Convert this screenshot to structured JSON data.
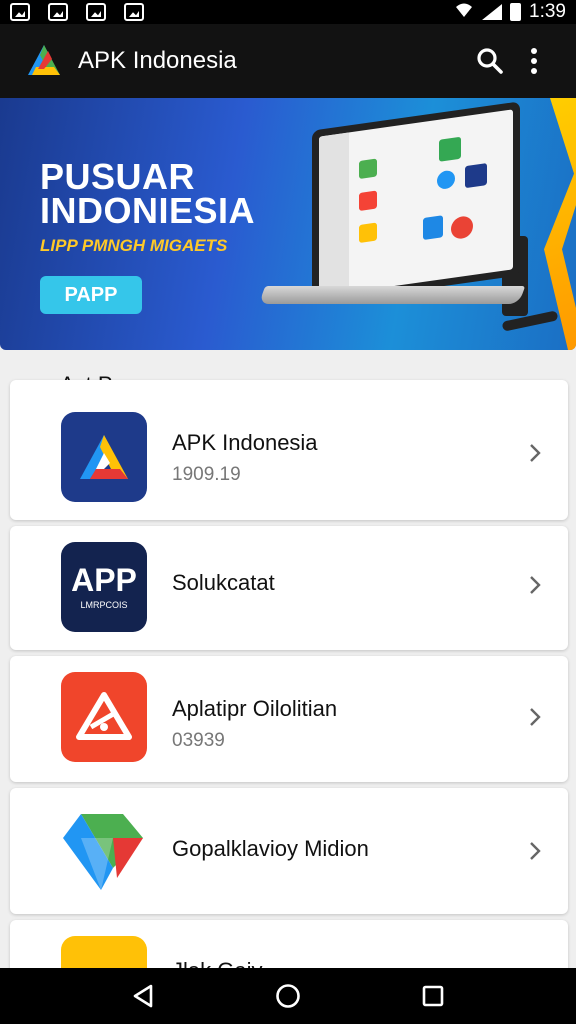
{
  "status_bar": {
    "time": "1:39"
  },
  "app_bar": {
    "title": "APK Indonesia",
    "search_icon": "search-icon",
    "menu_icon": "more-vert-icon"
  },
  "banner": {
    "title_line1": "PUSUAR",
    "title_line2": "INDONIESIA",
    "subtitle": "LIPP PMNGH  MIGAETS",
    "button_label": "PAPP"
  },
  "section": {
    "title": "Act Pusses"
  },
  "apps": [
    {
      "name": "APK Indonesia",
      "meta": "1909.19",
      "icon": "apk-indonesia-logo"
    },
    {
      "name": "Solukcatat",
      "meta": "",
      "icon": "app-logo",
      "icon_text": "APP",
      "icon_subtext": "LMRPCOIS"
    },
    {
      "name": "Aplatipr Oilolitian",
      "meta": "03939",
      "icon": "triangle-warning-logo"
    },
    {
      "name": "Gopalklavioy Midion",
      "meta": "",
      "icon": "geo-diamond-logo"
    },
    {
      "name": "Jlak Gaiv",
      "meta": "",
      "icon": "yellow-app-logo"
    }
  ],
  "colors": {
    "status_bar": "#000000",
    "app_bar": "#121212",
    "banner_accent": "#ffc928",
    "banner_button": "#35c6ea",
    "icon_blue": "#1e3a8a",
    "icon_navy": "#13234f",
    "icon_red": "#f0452b"
  }
}
